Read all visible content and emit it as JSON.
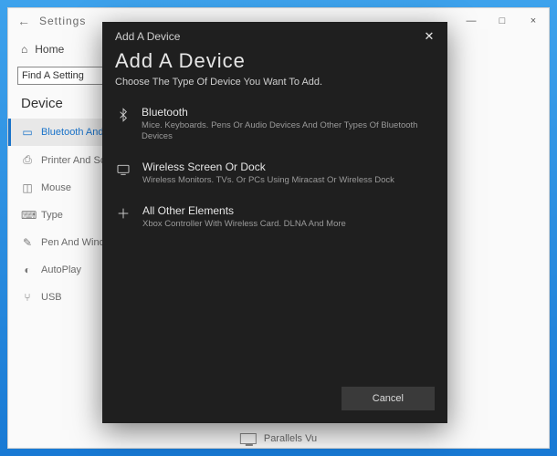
{
  "window": {
    "title": "Settings",
    "min": "—",
    "max": "□",
    "close": "×"
  },
  "side": {
    "home": "Home",
    "search_value": "Find A Setting",
    "section": "Device",
    "items": [
      {
        "label": "Bluetooth And Others d"
      },
      {
        "label": "Printer And Scanner"
      },
      {
        "label": "Mouse"
      },
      {
        "label": "Type"
      },
      {
        "label": "Pen And Windows"
      },
      {
        "label": "AutoPlay"
      },
      {
        "label": "USB"
      }
    ]
  },
  "bottom_device": "Parallels Vu",
  "modal": {
    "header": "Add A Device",
    "title": "Add A Device",
    "subtitle": "Choose The Type Of Device You Want To Add.",
    "options": [
      {
        "title": "Bluetooth",
        "desc": "Mice. Keyboards. Pens Or Audio Devices And Other Types Of Bluetooth Devices"
      },
      {
        "title": "Wireless Screen Or Dock",
        "desc": "Wireless Monitors. TVs. Or PCs Using Miracast Or Wireless Dock"
      },
      {
        "title": "All Other Elements",
        "desc": "Xbox Controller With Wireless Card. DLNA And More"
      }
    ],
    "cancel": "Cancel"
  }
}
